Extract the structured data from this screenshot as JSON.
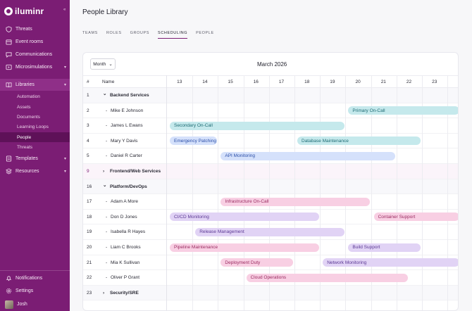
{
  "app": {
    "brand": "iluminr",
    "collapse_icon": "«"
  },
  "sidebar": {
    "items": [
      {
        "label": "Threats",
        "icon": "shield-icon"
      },
      {
        "label": "Event rooms",
        "icon": "calendar-icon"
      },
      {
        "label": "Communications",
        "icon": "message-icon"
      },
      {
        "label": "Microsimulations",
        "icon": "play-icon"
      },
      {
        "label": "Libraries",
        "icon": "book-icon"
      }
    ],
    "libraries_sub": [
      "Automation",
      "Assets",
      "Documents",
      "Learning Loops",
      "People",
      "Threats"
    ],
    "items_after": [
      {
        "label": "Templates",
        "icon": "template-icon"
      },
      {
        "label": "Resources",
        "icon": "stack-icon"
      }
    ],
    "bottom": [
      {
        "label": "Notifications",
        "icon": "bell-icon"
      },
      {
        "label": "Settings",
        "icon": "gear-icon"
      }
    ],
    "user": "Josh"
  },
  "page": {
    "title": "People Library"
  },
  "tabs": [
    "TEAMS",
    "ROLES",
    "GROUPS",
    "SCHEDULING",
    "PEOPLE"
  ],
  "active_tab": "SCHEDULING",
  "scheduler": {
    "view_select": "Month",
    "month": "March 2026",
    "col_num": "#",
    "col_name": "Name",
    "days": [
      "13",
      "14",
      "15",
      "16",
      "17",
      "18",
      "19",
      "20",
      "21",
      "22",
      "23"
    ],
    "rows": [
      {
        "num": "1",
        "name": "Backend Services",
        "type": "group-open"
      },
      {
        "num": "2",
        "name": "Mike E Johnson",
        "type": "person"
      },
      {
        "num": "3",
        "name": "James L Ewans",
        "type": "person"
      },
      {
        "num": "4",
        "name": "Mary Y Davis",
        "type": "person"
      },
      {
        "num": "5",
        "name": "Daniel R Carter",
        "type": "person"
      },
      {
        "num": "9",
        "name": "Frontend/Web Services",
        "type": "group-closed"
      },
      {
        "num": "16",
        "name": "Platform/DevOps",
        "type": "group-open"
      },
      {
        "num": "17",
        "name": "Adam A More",
        "type": "person"
      },
      {
        "num": "18",
        "name": "Don D Jones",
        "type": "person"
      },
      {
        "num": "19",
        "name": "Isabella R Hayes",
        "type": "person"
      },
      {
        "num": "20",
        "name": "Liam C Brooks",
        "type": "person"
      },
      {
        "num": "21",
        "name": "Mia K Sullivan",
        "type": "person"
      },
      {
        "num": "22",
        "name": "Oliver P Grant",
        "type": "person"
      },
      {
        "num": "23",
        "name": "Security/SRE",
        "type": "group-closed"
      }
    ],
    "bars": [
      {
        "row": 1,
        "label": "Primary On-Call",
        "start": 20.0,
        "end": 24.5,
        "color": "teal"
      },
      {
        "row": 2,
        "label": "Secondary On-Call",
        "start": 13.0,
        "end": 19.9,
        "color": "teal"
      },
      {
        "row": 3,
        "label": "Emergency Patching",
        "start": 13.0,
        "end": 14.9,
        "color": "blue"
      },
      {
        "row": 3,
        "label": "Database Maintenance",
        "start": 18.0,
        "end": 22.9,
        "color": "teal"
      },
      {
        "row": 4,
        "label": "API Monitoring",
        "start": 15.0,
        "end": 21.9,
        "color": "blue"
      },
      {
        "row": 7,
        "label": "Infrastructure On-Call",
        "start": 15.0,
        "end": 20.9,
        "color": "pink"
      },
      {
        "row": 8,
        "label": "CI/CD Monitoring",
        "start": 13.0,
        "end": 18.9,
        "color": "purple"
      },
      {
        "row": 8,
        "label": "Container Support",
        "start": 21.0,
        "end": 24.5,
        "color": "pink"
      },
      {
        "row": 9,
        "label": "Release Management",
        "start": 14.0,
        "end": 19.9,
        "color": "purple"
      },
      {
        "row": 10,
        "label": "Pipeline Maintenance",
        "start": 13.0,
        "end": 18.9,
        "color": "pink"
      },
      {
        "row": 10,
        "label": "Build Support",
        "start": 20.0,
        "end": 22.9,
        "color": "purple"
      },
      {
        "row": 11,
        "label": "Deployment Duty",
        "start": 15.0,
        "end": 17.9,
        "color": "pink"
      },
      {
        "row": 11,
        "label": "Network Monitoring",
        "start": 19.0,
        "end": 24.5,
        "color": "purple"
      },
      {
        "row": 12,
        "label": "Cloud Operations",
        "start": 16.0,
        "end": 22.4,
        "color": "pink"
      }
    ]
  }
}
